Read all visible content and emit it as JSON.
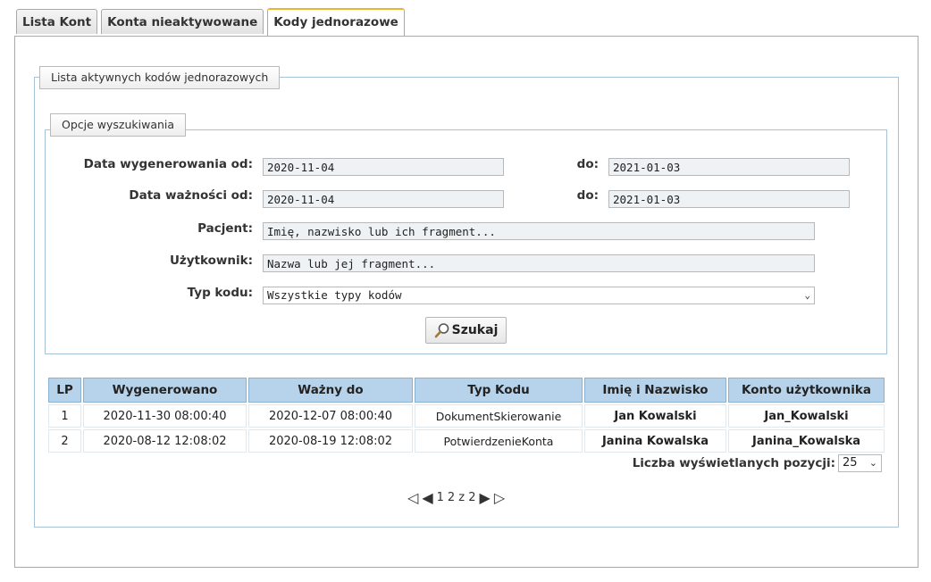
{
  "tabs": [
    {
      "label": "Lista Kont",
      "active": false
    },
    {
      "label": "Konta nieaktywowane",
      "active": false
    },
    {
      "label": "Kody jednorazowe",
      "active": true
    }
  ],
  "outer_legend": "Lista aktywnych kodów jednorazowych",
  "search": {
    "legend": "Opcje wyszukiwania",
    "generated_from_label": "Data wygenerowania od:",
    "generated_from": "2020-11-04",
    "generated_to_label": "do:",
    "generated_to": "2021-01-03",
    "valid_from_label": "Data ważności od:",
    "valid_from": "2020-11-04",
    "valid_to_label": "do:",
    "valid_to": "2021-01-03",
    "patient_label": "Pacjent:",
    "patient_placeholder": "Imię, nazwisko lub ich fragment...",
    "user_label": "Użytkownik:",
    "user_placeholder": "Nazwa lub jej fragment...",
    "code_type_label": "Typ kodu:",
    "code_type_value": "Wszystkie typy kodów",
    "search_button": "Szukaj"
  },
  "table": {
    "headers": [
      "LP",
      "Wygenerowano",
      "Ważny do",
      "Typ Kodu",
      "Imię i Nazwisko",
      "Konto użytkownika"
    ],
    "rows": [
      [
        "1",
        "2020-11-30 08:00:40",
        "2020-12-07 08:00:40",
        "DokumentSkierowanie",
        "Jan Kowalski",
        "Jan_Kowalski"
      ],
      [
        "2",
        "2020-08-12 12:08:02",
        "2020-08-19 12:08:02",
        "PotwierdzenieKonta",
        "Janina Kowalska",
        "Janina_Kowalska"
      ]
    ]
  },
  "page_size": {
    "label": "Liczba wyświetlanych pozycji:",
    "value": "25"
  },
  "pager": {
    "current": "1",
    "separator": "2 z 2"
  }
}
